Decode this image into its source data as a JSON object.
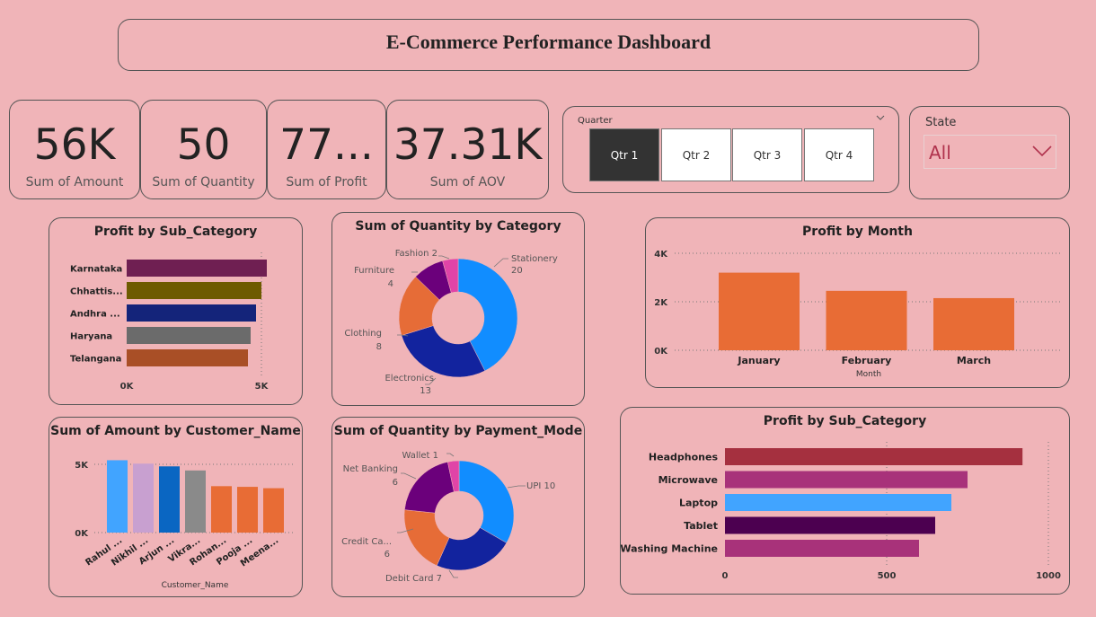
{
  "title": "E-Commerce Performance Dashboard",
  "kpis": [
    {
      "value": "56K",
      "label": "Sum of Amount"
    },
    {
      "value": "50",
      "label": "Sum of Quantity"
    },
    {
      "value": "77...",
      "label": "Sum of Profit"
    },
    {
      "value": "37.31K",
      "label": "Sum of AOV"
    }
  ],
  "quarter_slicer": {
    "header": "Quarter",
    "options": [
      "Qtr 1",
      "Qtr 2",
      "Qtr 3",
      "Qtr 4"
    ],
    "selected": "Qtr 1"
  },
  "state_slicer": {
    "header": "State",
    "value": "All"
  },
  "colors": {
    "background": "#f0b4b8",
    "orange": "#e86c35",
    "selected_btn": "#333333"
  },
  "chart_data": [
    {
      "id": "profit_by_state",
      "type": "bar",
      "orientation": "horizontal",
      "title": "Profit by Sub_Category",
      "categories": [
        "Karnataka",
        "Chhattis...",
        "Andhra ...",
        "Haryana",
        "Telangana"
      ],
      "values": [
        5200,
        5000,
        4800,
        4600,
        4500
      ],
      "colors": [
        "#6f1f52",
        "#6e5b00",
        "#14247a",
        "#6b6b6b",
        "#a94f26"
      ],
      "ticks": [
        "0K",
        "5K"
      ],
      "xlim": [
        0,
        5000
      ]
    },
    {
      "id": "qty_by_category",
      "type": "pie",
      "donut": true,
      "title": "Sum of Quantity by Category",
      "labels": [
        "Stationery",
        "Electronics",
        "Clothing",
        "Furniture",
        "Fashion"
      ],
      "values": [
        20,
        13,
        8,
        4,
        2
      ],
      "colors": [
        "#118dff",
        "#12239e",
        "#e66c37",
        "#6b007b",
        "#e044a7"
      ],
      "extra_slice_color": "#744ec2",
      "label_texts": [
        "Stationery",
        "20",
        "Electronics",
        "13",
        "Clothing",
        "8",
        "Furniture",
        "4",
        "Fashion 2"
      ]
    },
    {
      "id": "profit_by_month",
      "type": "bar",
      "title": "Profit by Month",
      "categories": [
        "January",
        "February",
        "March"
      ],
      "values": [
        3200,
        2450,
        2150
      ],
      "xlabel": "Month",
      "ticks": [
        "4K",
        "2K",
        "0K"
      ],
      "ylim": [
        0,
        4000
      ],
      "color": "#e86c35"
    },
    {
      "id": "amount_by_customer",
      "type": "bar",
      "title": "Sum of Amount by Customer_Name",
      "categories": [
        "Rahul ...",
        "Nikhil ...",
        "Arjun ...",
        "Vikra...",
        "Rohan...",
        "Pooja ...",
        "Meena..."
      ],
      "values": [
        5300,
        5050,
        4850,
        4550,
        3400,
        3350,
        3250
      ],
      "colors": [
        "#41a4ff",
        "#c8a0d0",
        "#0a66c2",
        "#8a8a8a",
        "#e86c35",
        "#e86c35",
        "#e86c35"
      ],
      "xlabel": "Customer_Name",
      "ticks": [
        "5K",
        "0K"
      ],
      "ylim": [
        0,
        5000
      ]
    },
    {
      "id": "qty_by_payment",
      "type": "pie",
      "donut": true,
      "title": "Sum of Quantity by Payment_Mode",
      "labels": [
        "UPI",
        "Debit Card",
        "Credit Ca...",
        "Net Banking",
        "Wallet"
      ],
      "values": [
        10,
        7,
        6,
        6,
        1
      ],
      "colors": [
        "#118dff",
        "#12239e",
        "#e66c37",
        "#6b007b",
        "#e044a7"
      ],
      "label_texts": [
        "UPI 10",
        "Debit Card 7",
        "Credit Ca...",
        "6",
        "Net Banking",
        "6",
        "Wallet 1"
      ]
    },
    {
      "id": "profit_by_subcat",
      "type": "bar",
      "orientation": "horizontal",
      "title": "Profit by Sub_Category",
      "categories": [
        "Headphones",
        "Microwave",
        "Laptop",
        "Tablet",
        "Washing Machine"
      ],
      "values": [
        920,
        750,
        700,
        650,
        600
      ],
      "colors": [
        "#a5303f",
        "#a8327a",
        "#41a4ff",
        "#4c0050",
        "#a8327a"
      ],
      "ticks": [
        "0",
        "500",
        "1000"
      ],
      "xlim": [
        0,
        1000
      ]
    }
  ]
}
